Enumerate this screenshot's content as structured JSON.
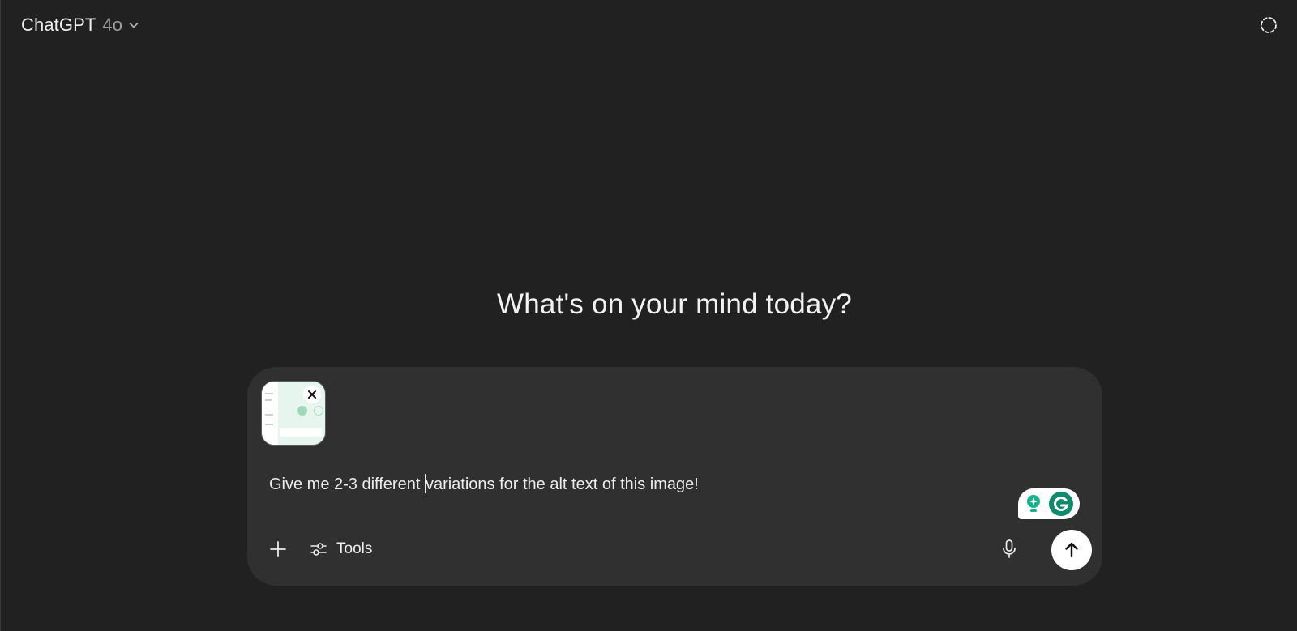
{
  "header": {
    "model_name": "ChatGPT",
    "model_version": "4o",
    "chevron_icon": "chevron-down-icon",
    "temporary_chat_icon": "dashed-circle-icon"
  },
  "main": {
    "headline": "What's on your mind today?"
  },
  "composer": {
    "attachment": {
      "type": "image-thumbnail",
      "remove_icon": "close-icon"
    },
    "prompt_before_caret": "Give me 2-3 different ",
    "prompt_after_caret": "variations for the alt text of this image!",
    "grammarly_icons": [
      "lightbulb-icon",
      "grammarly-icon"
    ],
    "add_icon": "plus-icon",
    "tools_label": "Tools",
    "tools_icon": "sliders-icon",
    "mic_icon": "microphone-icon",
    "send_icon": "arrow-up-icon"
  },
  "colors": {
    "background": "#212121",
    "composer_background": "#303030",
    "text": "#ececec",
    "muted_text": "#9b9b9b",
    "grammarly_green": "#15c39a"
  }
}
